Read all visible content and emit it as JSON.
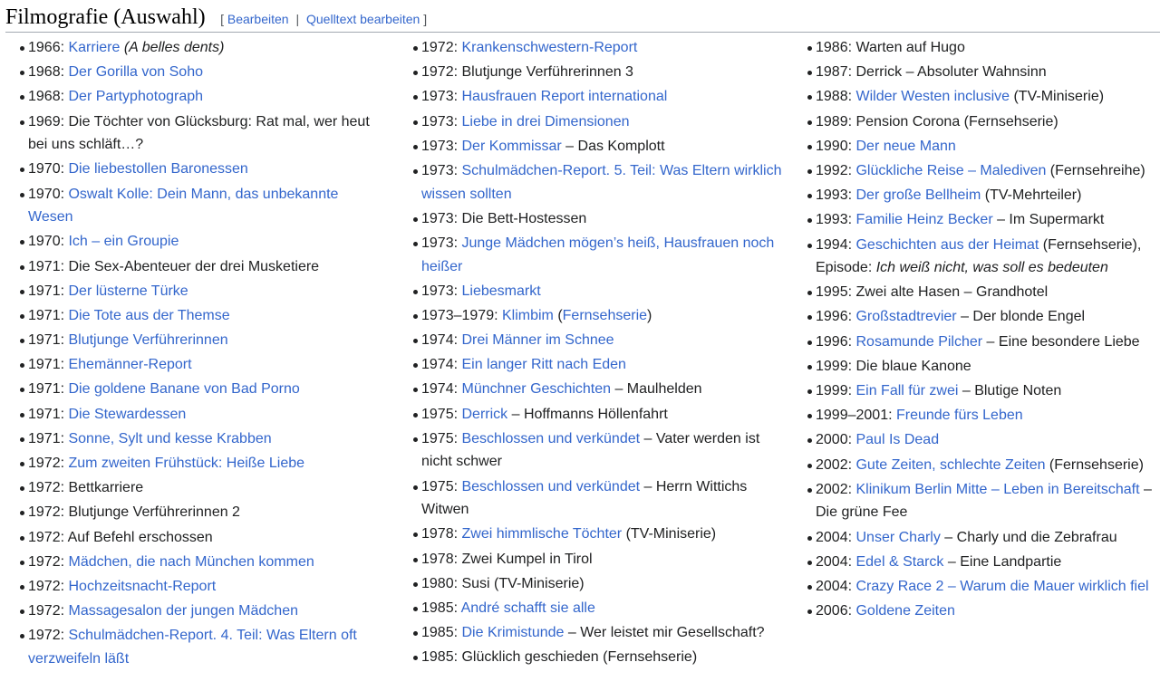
{
  "section": {
    "title": "Filmografie (Auswahl)",
    "bracket_open": "[",
    "edit": "Bearbeiten",
    "separator": "|",
    "edit_source": "Quelltext bearbeiten",
    "bracket_close": "]"
  },
  "columns": [
    [
      [
        {
          "t": "1966: "
        },
        {
          "t": "Karriere",
          "l": 1
        },
        {
          "t": " "
        },
        {
          "t": "(A belles dents)",
          "i": 1
        }
      ],
      [
        {
          "t": "1968: "
        },
        {
          "t": "Der Gorilla von Soho",
          "l": 1
        }
      ],
      [
        {
          "t": "1968: "
        },
        {
          "t": "Der Partyphotograph",
          "l": 1
        }
      ],
      [
        {
          "t": "1969: Die Töchter von Glücksburg: Rat mal, wer heut bei uns schläft…?"
        }
      ],
      [
        {
          "t": "1970: "
        },
        {
          "t": "Die liebestollen Baronessen",
          "l": 1
        }
      ],
      [
        {
          "t": "1970: "
        },
        {
          "t": "Oswalt Kolle: Dein Mann, das unbekannte Wesen",
          "l": 1
        }
      ],
      [
        {
          "t": "1970: "
        },
        {
          "t": "Ich – ein Groupie",
          "l": 1
        }
      ],
      [
        {
          "t": "1971: Die Sex-Abenteuer der drei Musketiere"
        }
      ],
      [
        {
          "t": "1971: "
        },
        {
          "t": "Der lüsterne Türke",
          "l": 1
        }
      ],
      [
        {
          "t": "1971: "
        },
        {
          "t": "Die Tote aus der Themse",
          "l": 1
        }
      ],
      [
        {
          "t": "1971: "
        },
        {
          "t": "Blutjunge Verführerinnen",
          "l": 1
        }
      ],
      [
        {
          "t": "1971: "
        },
        {
          "t": "Ehemänner-Report",
          "l": 1
        }
      ],
      [
        {
          "t": "1971: "
        },
        {
          "t": "Die goldene Banane von Bad Porno",
          "l": 1
        }
      ],
      [
        {
          "t": "1971: "
        },
        {
          "t": "Die Stewardessen",
          "l": 1
        }
      ],
      [
        {
          "t": "1971: "
        },
        {
          "t": "Sonne, Sylt und kesse Krabben",
          "l": 1
        }
      ],
      [
        {
          "t": "1972: "
        },
        {
          "t": "Zum zweiten Frühstück: Heiße Liebe",
          "l": 1
        }
      ],
      [
        {
          "t": "1972: Bettkarriere"
        }
      ],
      [
        {
          "t": "1972: Blutjunge Verführerinnen 2"
        }
      ],
      [
        {
          "t": "1972: Auf Befehl erschossen"
        }
      ],
      [
        {
          "t": "1972: "
        },
        {
          "t": "Mädchen, die nach München kommen",
          "l": 1
        }
      ],
      [
        {
          "t": "1972: "
        },
        {
          "t": "Hochzeitsnacht-Report",
          "l": 1
        }
      ],
      [
        {
          "t": "1972: "
        },
        {
          "t": "Massagesalon der jungen Mädchen",
          "l": 1
        }
      ],
      [
        {
          "t": "1972: "
        },
        {
          "t": "Schulmädchen-Report. 4. Teil: Was Eltern oft verzweifeln läßt",
          "l": 1
        }
      ]
    ],
    [
      [
        {
          "t": "1972: "
        },
        {
          "t": "Krankenschwestern-Report",
          "l": 1
        }
      ],
      [
        {
          "t": "1972: Blutjunge Verführerinnen 3"
        }
      ],
      [
        {
          "t": "1973: "
        },
        {
          "t": "Hausfrauen Report international",
          "l": 1
        }
      ],
      [
        {
          "t": "1973: "
        },
        {
          "t": "Liebe in drei Dimensionen",
          "l": 1
        }
      ],
      [
        {
          "t": "1973: "
        },
        {
          "t": "Der Kommissar",
          "l": 1
        },
        {
          "t": " – Das Komplott"
        }
      ],
      [
        {
          "t": "1973: "
        },
        {
          "t": "Schulmädchen-Report. 5. Teil: Was Eltern wirklich wissen sollten",
          "l": 1
        }
      ],
      [
        {
          "t": "1973: Die Bett-Hostessen"
        }
      ],
      [
        {
          "t": "1973: "
        },
        {
          "t": "Junge Mädchen mögen’s heiß, Hausfrauen noch heißer",
          "l": 1
        }
      ],
      [
        {
          "t": "1973: "
        },
        {
          "t": "Liebesmarkt",
          "l": 1
        }
      ],
      [
        {
          "t": "1973–1979: "
        },
        {
          "t": "Klimbim",
          "l": 1
        },
        {
          "t": " ("
        },
        {
          "t": "Fernsehserie",
          "l": 1
        },
        {
          "t": ")"
        }
      ],
      [
        {
          "t": "1974: "
        },
        {
          "t": "Drei Männer im Schnee",
          "l": 1
        }
      ],
      [
        {
          "t": "1974: "
        },
        {
          "t": "Ein langer Ritt nach Eden",
          "l": 1
        }
      ],
      [
        {
          "t": "1974: "
        },
        {
          "t": "Münchner Geschichten",
          "l": 1
        },
        {
          "t": " – Maulhelden"
        }
      ],
      [
        {
          "t": "1975: "
        },
        {
          "t": "Derrick",
          "l": 1
        },
        {
          "t": " – Hoffmanns Höllenfahrt"
        }
      ],
      [
        {
          "t": "1975: "
        },
        {
          "t": "Beschlossen und verkündet",
          "l": 1
        },
        {
          "t": " – Vater werden ist nicht schwer"
        }
      ],
      [
        {
          "t": "1975: "
        },
        {
          "t": "Beschlossen und verkündet",
          "l": 1
        },
        {
          "t": " – Herrn Wittichs Witwen"
        }
      ],
      [
        {
          "t": "1978: "
        },
        {
          "t": "Zwei himmlische Töchter",
          "l": 1
        },
        {
          "t": " (TV-Miniserie)"
        }
      ],
      [
        {
          "t": "1978: Zwei Kumpel in Tirol"
        }
      ],
      [
        {
          "t": "1980: Susi (TV-Miniserie)"
        }
      ],
      [
        {
          "t": "1985: "
        },
        {
          "t": "André schafft sie alle",
          "l": 1
        }
      ],
      [
        {
          "t": "1985: "
        },
        {
          "t": "Die Krimistunde",
          "l": 1
        },
        {
          "t": " – Wer leistet mir Gesellschaft?"
        }
      ],
      [
        {
          "t": "1985: Glücklich geschieden (Fernsehserie)"
        }
      ]
    ],
    [
      [
        {
          "t": "1986: Warten auf Hugo"
        }
      ],
      [
        {
          "t": "1987: Derrick – Absoluter Wahnsinn"
        }
      ],
      [
        {
          "t": "1988: "
        },
        {
          "t": "Wilder Westen inclusive",
          "l": 1
        },
        {
          "t": " (TV-Miniserie)"
        }
      ],
      [
        {
          "t": "1989: Pension Corona (Fernsehserie)"
        }
      ],
      [
        {
          "t": "1990: "
        },
        {
          "t": "Der neue Mann",
          "l": 1
        }
      ],
      [
        {
          "t": "1992: "
        },
        {
          "t": "Glückliche Reise – Malediven",
          "l": 1
        },
        {
          "t": " (Fernsehreihe)"
        }
      ],
      [
        {
          "t": "1993: "
        },
        {
          "t": "Der große Bellheim",
          "l": 1
        },
        {
          "t": " (TV-Mehrteiler)"
        }
      ],
      [
        {
          "t": "1993: "
        },
        {
          "t": "Familie Heinz Becker",
          "l": 1
        },
        {
          "t": " – Im Supermarkt"
        }
      ],
      [
        {
          "t": "1994: "
        },
        {
          "t": "Geschichten aus der Heimat",
          "l": 1
        },
        {
          "t": " (Fernsehserie), Episode: "
        },
        {
          "t": "Ich weiß nicht, was soll es bedeuten",
          "i": 1
        }
      ],
      [
        {
          "t": "1995: Zwei alte Hasen – Grandhotel"
        }
      ],
      [
        {
          "t": "1996: "
        },
        {
          "t": "Großstadtrevier",
          "l": 1
        },
        {
          "t": " – Der blonde Engel"
        }
      ],
      [
        {
          "t": "1996: "
        },
        {
          "t": "Rosamunde Pilcher",
          "l": 1
        },
        {
          "t": " – Eine besondere Liebe"
        }
      ],
      [
        {
          "t": "1999: Die blaue Kanone"
        }
      ],
      [
        {
          "t": "1999: "
        },
        {
          "t": "Ein Fall für zwei",
          "l": 1
        },
        {
          "t": " – Blutige Noten"
        }
      ],
      [
        {
          "t": "1999–2001: "
        },
        {
          "t": "Freunde fürs Leben",
          "l": 1
        }
      ],
      [
        {
          "t": "2000: "
        },
        {
          "t": "Paul Is Dead",
          "l": 1
        }
      ],
      [
        {
          "t": "2002: "
        },
        {
          "t": "Gute Zeiten, schlechte Zeiten",
          "l": 1
        },
        {
          "t": " (Fernsehserie)"
        }
      ],
      [
        {
          "t": "2002: "
        },
        {
          "t": "Klinikum Berlin Mitte – Leben in Bereitschaft",
          "l": 1
        },
        {
          "t": " – Die grüne Fee"
        }
      ],
      [
        {
          "t": "2004: "
        },
        {
          "t": "Unser Charly",
          "l": 1
        },
        {
          "t": " – Charly und die Zebrafrau"
        }
      ],
      [
        {
          "t": "2004: "
        },
        {
          "t": "Edel & Starck",
          "l": 1
        },
        {
          "t": " – Eine Landpartie"
        }
      ],
      [
        {
          "t": "2004: "
        },
        {
          "t": "Crazy Race 2 – Warum die Mauer wirklich fiel",
          "l": 1
        }
      ],
      [
        {
          "t": "2006: "
        },
        {
          "t": "Goldene Zeiten",
          "l": 1
        }
      ]
    ]
  ]
}
